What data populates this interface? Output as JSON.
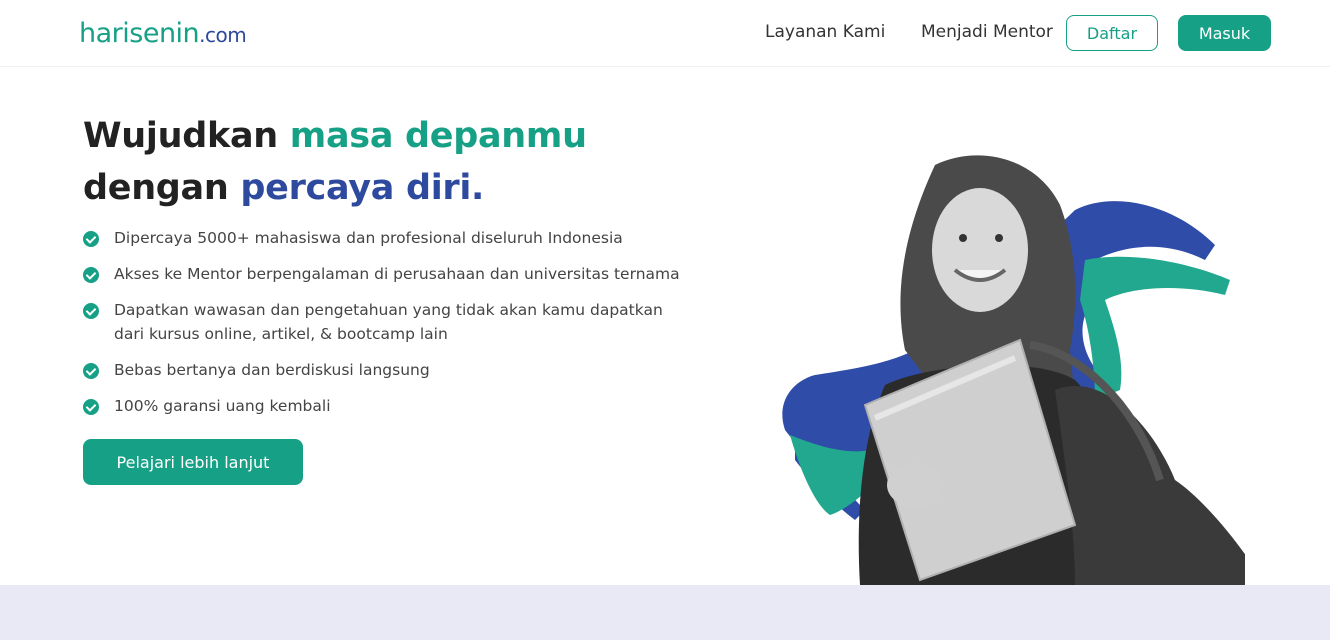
{
  "header": {
    "logo_main": "harisenin",
    "logo_suffix": ".com",
    "nav": [
      "Layanan Kami",
      "Menjadi Mentor"
    ],
    "register_label": "Daftar",
    "login_label": "Masuk"
  },
  "hero": {
    "headline_line1_plain": "Wujudkan ",
    "headline_line1_accent": "masa depanmu",
    "headline_line2_plain": "dengan ",
    "headline_line2_accent": "percaya diri.",
    "features": [
      "Dipercaya 5000+ mahasiswa dan profesional diseluruh Indonesia",
      "Akses ke Mentor berpengalaman di perusahaan dan universitas ternama",
      "Dapatkan wawasan dan pengetahuan yang tidak akan kamu dapatkan dari kursus online, artikel, & bootcamp lain",
      "Bebas bertanya dan berdiskusi langsung",
      "100% garansi uang kembali"
    ],
    "cta_label": "Pelajari lebih lanjut"
  },
  "colors": {
    "brand_green": "#16a085",
    "brand_blue": "#2e4a9e",
    "band": "#e8e9f5"
  }
}
